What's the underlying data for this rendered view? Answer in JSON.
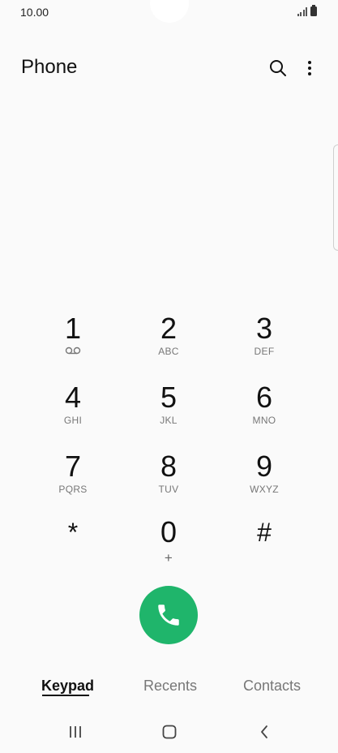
{
  "status_bar": {
    "time": "10.00"
  },
  "header": {
    "title": "Phone",
    "icons": [
      "search-icon",
      "more-options-icon"
    ]
  },
  "keypad": {
    "keys": [
      {
        "digit": "1",
        "letters": ""
      },
      {
        "digit": "2",
        "letters": "ABC"
      },
      {
        "digit": "3",
        "letters": "DEF"
      },
      {
        "digit": "4",
        "letters": "GHI"
      },
      {
        "digit": "5",
        "letters": "JKL"
      },
      {
        "digit": "6",
        "letters": "MNO"
      },
      {
        "digit": "7",
        "letters": "PQRS"
      },
      {
        "digit": "8",
        "letters": "TUV"
      },
      {
        "digit": "9",
        "letters": "WXYZ"
      },
      {
        "digit": "*",
        "letters": ""
      },
      {
        "digit": "0",
        "letters": "+"
      },
      {
        "digit": "#",
        "letters": ""
      }
    ]
  },
  "call": {
    "icon": "phone-icon",
    "color": "#1fb56b"
  },
  "tabs": [
    {
      "label": "Keypad",
      "active": true
    },
    {
      "label": "Recents",
      "active": false
    },
    {
      "label": "Contacts",
      "active": false
    }
  ],
  "nav_bar": {
    "icons": [
      "recent-apps-icon",
      "home-icon",
      "back-icon"
    ]
  }
}
